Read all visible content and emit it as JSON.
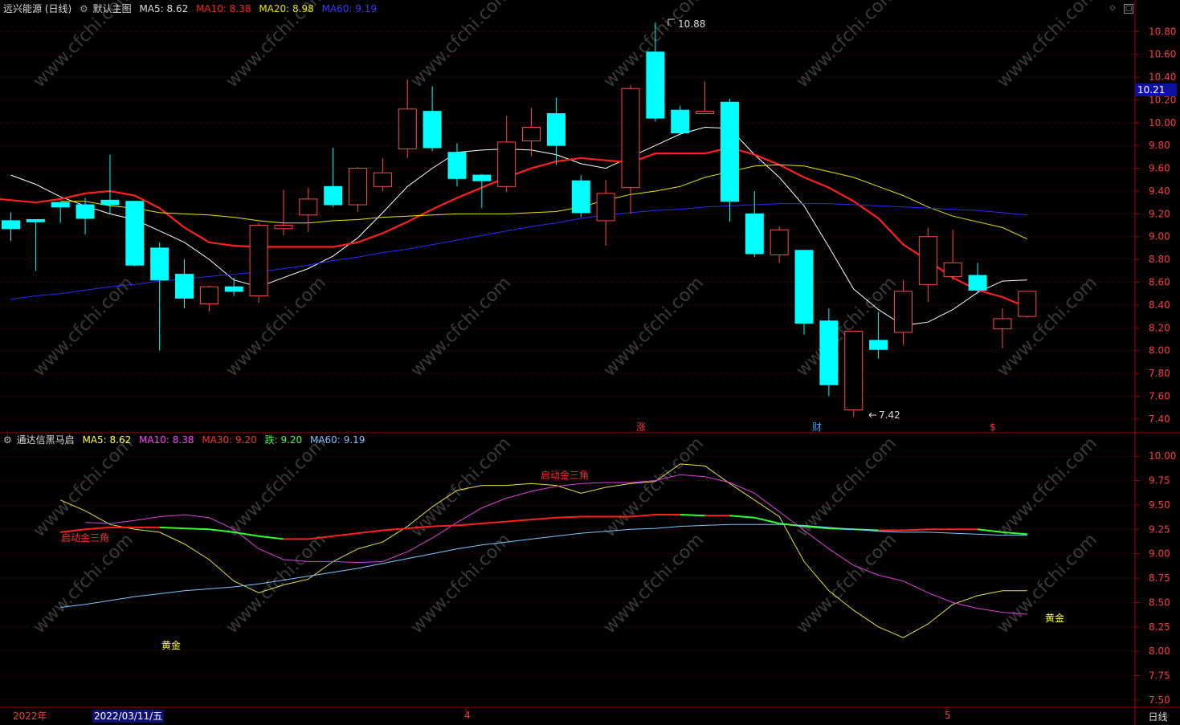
{
  "colors": {
    "up": "#ff4a4a",
    "down": "#00ffff",
    "ma5": "#ffffff",
    "ma10": "#ff2020",
    "ma20": "#e6e600",
    "ma60": "#2a2aff",
    "grid": "#7a0000",
    "axis_text": "#ff3c3c"
  },
  "main_header": {
    "title": "远兴能源 (日线)",
    "panel_name": "默认主图",
    "ma5_label": "MA5:",
    "ma5_value": "8.62",
    "ma10_label": "MA10:",
    "ma10_value": "8.38",
    "ma20_label": "MA20:",
    "ma20_value": "8.98",
    "ma60_label": "MA60:",
    "ma60_value": "9.19"
  },
  "sub_header": {
    "title": "通达信黑马启",
    "ma5_label": "MA5:",
    "ma5_value": "8.62",
    "ma10_label": "MA10:",
    "ma10_value": "8.38",
    "ma30_label": "MA30:",
    "ma30_value": "9.20",
    "die_label": "跌:",
    "die_value": "9.20",
    "ma60_label": "MA60:",
    "ma60_value": "9.19"
  },
  "price_axis": [
    "10.80",
    "10.60",
    "10.40",
    "10.20",
    "10.00",
    "9.80",
    "9.60",
    "9.40",
    "9.20",
    "9.00",
    "8.80",
    "8.60",
    "8.40",
    "8.20",
    "8.00",
    "7.80",
    "7.60",
    "7.40"
  ],
  "current_price": "10.21",
  "sub_axis": [
    "10.00",
    "9.75",
    "9.50",
    "9.25",
    "9.00",
    "8.75",
    "8.50",
    "8.25",
    "8.00",
    "7.75",
    "7.50"
  ],
  "high_marker": "10.88",
  "low_marker": "7.42",
  "event_markers": [
    "涨",
    "财",
    "$"
  ],
  "sub_annotations": [
    "启动金三角",
    "启动金三角",
    "黄金",
    "黄金"
  ],
  "bottom_bar": {
    "year": "2022年",
    "cursor_date": "2022/03/11/五",
    "month_4": "4",
    "month_5": "5",
    "period": "日线"
  },
  "chart_data": {
    "type": "candlestick",
    "series": [
      {
        "name": "K",
        "ohlc": [
          [
            9.14,
            9.21,
            8.96,
            9.07
          ],
          [
            9.15,
            9.15,
            8.7,
            9.13
          ],
          [
            9.3,
            9.3,
            9.12,
            9.26
          ],
          [
            9.28,
            9.34,
            9.02,
            9.16
          ],
          [
            9.32,
            9.72,
            9.2,
            9.28
          ],
          [
            9.31,
            9.31,
            8.74,
            8.75
          ],
          [
            8.9,
            8.95,
            8.0,
            8.62
          ],
          [
            8.67,
            8.8,
            8.37,
            8.46
          ],
          [
            8.41,
            8.57,
            8.34,
            8.56
          ],
          [
            8.56,
            8.64,
            8.48,
            8.52
          ],
          [
            8.48,
            9.12,
            8.42,
            9.1
          ],
          [
            9.07,
            9.41,
            9.01,
            9.1
          ],
          [
            9.19,
            9.43,
            9.04,
            9.33
          ],
          [
            9.44,
            9.78,
            9.26,
            9.28
          ],
          [
            9.28,
            9.61,
            9.22,
            9.6
          ],
          [
            9.44,
            9.69,
            9.4,
            9.56
          ],
          [
            9.77,
            10.38,
            9.69,
            10.12
          ],
          [
            10.1,
            10.32,
            9.75,
            9.78
          ],
          [
            9.74,
            9.82,
            9.44,
            9.51
          ],
          [
            9.54,
            9.55,
            9.25,
            9.49
          ],
          [
            9.44,
            10.06,
            9.39,
            9.83
          ],
          [
            9.84,
            10.13,
            9.71,
            9.96
          ],
          [
            10.08,
            10.22,
            9.63,
            9.8
          ],
          [
            9.49,
            9.54,
            9.17,
            9.21
          ],
          [
            9.14,
            9.5,
            8.92,
            9.38
          ],
          [
            9.43,
            10.33,
            9.2,
            10.3
          ],
          [
            10.62,
            10.88,
            10.01,
            10.04
          ],
          [
            10.11,
            10.15,
            9.89,
            9.91
          ],
          [
            10.08,
            10.36,
            10.08,
            10.1
          ],
          [
            10.18,
            10.21,
            9.13,
            9.31
          ],
          [
            9.2,
            9.4,
            8.82,
            8.85
          ],
          [
            8.84,
            9.09,
            8.77,
            9.06
          ],
          [
            8.88,
            8.88,
            8.14,
            8.24
          ],
          [
            8.26,
            8.37,
            7.6,
            7.7
          ],
          [
            7.48,
            8.17,
            7.42,
            8.17
          ],
          [
            8.09,
            8.34,
            7.93,
            8.01
          ],
          [
            8.16,
            8.62,
            8.05,
            8.52
          ],
          [
            8.58,
            9.08,
            8.43,
            9.0
          ],
          [
            8.65,
            9.06,
            8.62,
            8.77
          ],
          [
            8.66,
            8.77,
            8.5,
            8.53
          ],
          [
            8.19,
            8.37,
            8.02,
            8.28
          ],
          [
            8.3,
            8.52,
            8.29,
            8.52
          ]
        ]
      },
      {
        "name": "MA5",
        "values": [
          9.54,
          9.46,
          9.35,
          9.27,
          9.2,
          9.15,
          9.05,
          8.95,
          8.8,
          8.62,
          8.56,
          8.64,
          8.72,
          8.83,
          8.99,
          9.21,
          9.44,
          9.6,
          9.74,
          9.76,
          9.77,
          9.76,
          9.72,
          9.64,
          9.6,
          9.7,
          9.8,
          9.9,
          9.96,
          9.95,
          9.72,
          9.52,
          9.27,
          8.91,
          8.54,
          8.36,
          8.22,
          8.25,
          8.36,
          8.51,
          8.61,
          8.62
        ]
      },
      {
        "name": "MA10",
        "values": [
          9.34,
          9.32,
          9.3,
          9.33,
          9.38,
          9.4,
          9.36,
          9.25,
          9.08,
          8.95,
          8.92,
          8.91,
          8.91,
          8.91,
          8.91,
          8.95,
          9.03,
          9.13,
          9.24,
          9.34,
          9.43,
          9.52,
          9.6,
          9.66,
          9.69,
          9.67,
          9.65,
          9.73,
          9.73,
          9.73,
          9.78,
          9.72,
          9.63,
          9.52,
          9.43,
          9.31,
          9.16,
          8.93,
          8.79,
          8.64,
          8.53,
          8.47,
          8.38
        ]
      },
      {
        "name": "MA20",
        "values": [
          9.31,
          9.31,
          9.27,
          9.25,
          9.21,
          9.2,
          9.19,
          9.17,
          9.14,
          9.12,
          9.12,
          9.14,
          9.15,
          9.17,
          9.18,
          9.19,
          9.2,
          9.2,
          9.2,
          9.21,
          9.22,
          9.26,
          9.32,
          9.37,
          9.4,
          9.44,
          9.52,
          9.57,
          9.62,
          9.63,
          9.62,
          9.57,
          9.52,
          9.44,
          9.36,
          9.26,
          9.18,
          9.13,
          9.08,
          8.98
        ]
      },
      {
        "name": "MA60",
        "values": [
          8.45,
          8.48,
          8.5,
          8.53,
          8.56,
          8.58,
          8.61,
          8.63,
          8.65,
          8.67,
          8.69,
          8.72,
          8.75,
          8.79,
          8.82,
          8.86,
          8.89,
          8.93,
          8.97,
          9.01,
          9.05,
          9.09,
          9.12,
          9.16,
          9.19,
          9.21,
          9.23,
          9.24,
          9.26,
          9.27,
          9.28,
          9.29,
          9.29,
          9.29,
          9.28,
          9.27,
          9.26,
          9.25,
          9.24,
          9.23,
          9.21,
          9.19
        ]
      }
    ],
    "sub_series": [
      {
        "name": "MA5",
        "values": [
          9.55,
          9.44,
          9.3,
          9.25,
          9.22,
          9.1,
          8.94,
          8.72,
          8.6,
          8.68,
          8.74,
          8.92,
          9.05,
          9.12,
          9.28,
          9.48,
          9.65,
          9.7,
          9.7,
          9.72,
          9.7,
          9.62,
          9.68,
          9.72,
          9.74,
          9.92,
          9.9,
          9.72,
          9.55,
          9.38,
          8.92,
          8.62,
          8.42,
          8.25,
          8.14,
          8.28,
          8.48,
          8.57,
          8.62,
          8.62
        ]
      },
      {
        "name": "MA10",
        "values": [
          9.32,
          9.31,
          9.34,
          9.38,
          9.4,
          9.37,
          9.25,
          9.05,
          8.94,
          8.92,
          8.92,
          8.91,
          8.92,
          9.02,
          9.16,
          9.32,
          9.47,
          9.57,
          9.64,
          9.69,
          9.72,
          9.73,
          9.73,
          9.75,
          9.81,
          9.79,
          9.73,
          9.62,
          9.43,
          9.24,
          9.05,
          8.88,
          8.78,
          8.72,
          8.6,
          8.5,
          8.44,
          8.4,
          8.38
        ]
      },
      {
        "name": "MA30",
        "values": [
          9.22,
          9.25,
          9.27,
          9.27,
          9.27,
          9.26,
          9.25,
          9.22,
          9.18,
          9.15,
          9.15,
          9.18,
          9.21,
          9.24,
          9.26,
          9.28,
          9.29,
          9.31,
          9.33,
          9.35,
          9.37,
          9.38,
          9.38,
          9.38,
          9.4,
          9.4,
          9.39,
          9.39,
          9.37,
          9.31,
          9.28,
          9.26,
          9.25,
          9.24,
          9.24,
          9.25,
          9.25,
          9.25,
          9.22,
          9.2
        ]
      },
      {
        "name": "MA60",
        "values": [
          8.45,
          8.48,
          8.52,
          8.56,
          8.59,
          8.62,
          8.64,
          8.66,
          8.69,
          8.73,
          8.77,
          8.81,
          8.85,
          8.9,
          8.95,
          9.0,
          9.05,
          9.09,
          9.12,
          9.15,
          9.18,
          9.21,
          9.23,
          9.25,
          9.26,
          9.28,
          9.29,
          9.3,
          9.3,
          9.3,
          9.29,
          9.27,
          9.25,
          9.23,
          9.22,
          9.22,
          9.21,
          9.2,
          9.19,
          9.19
        ]
      }
    ],
    "ylim": [
      7.3,
      10.95
    ],
    "sub_ylim": [
      7.45,
      10.1
    ],
    "grid": true
  }
}
